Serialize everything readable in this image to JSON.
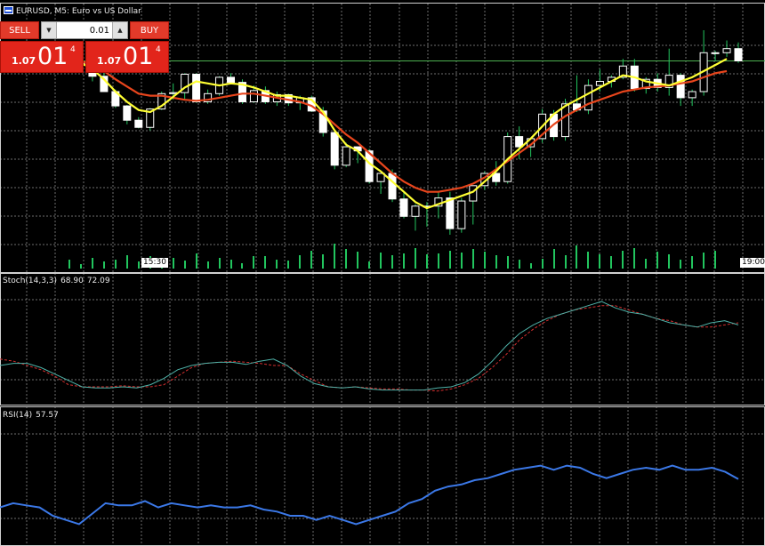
{
  "symbol_title": "EURUSD, M5:  Euro vs US Dollar",
  "trade_panel": {
    "sell_label": "SELL",
    "buy_label": "BUY",
    "lot_value": "0.01",
    "sell_price": {
      "small": "1.07",
      "big": "01",
      "sup": "4"
    },
    "buy_price": {
      "small": "1.07",
      "big": "01",
      "sup": "4"
    },
    "down_arrow": "▼",
    "up_arrow": "▲"
  },
  "time_labels": [
    "15:30",
    "19:00"
  ],
  "indicators": {
    "stoch": {
      "name": "Stoch(14,3,3)",
      "main": "68.90",
      "signal": "72.09"
    },
    "rsi": {
      "name": "RSI(14)",
      "value": "57.57"
    }
  },
  "colors": {
    "background": "#000000",
    "grid": "#c8c8c8",
    "bull": "#ffffff",
    "bear": "#ffffff",
    "wick": "#22c55e",
    "fast_ma": "#ffff33",
    "slow_ma": "#e8451c",
    "stoch_main": "#4fb3a9",
    "stoch_signal": "#d32f2f",
    "rsi": "#3b78e7",
    "volume": "#22c55e",
    "price_line": "#4caf50",
    "sell_button": "#e23a2a"
  },
  "chart_data": {
    "type": "candlestick",
    "candles": [
      {
        "o": 9,
        "h": 14,
        "l": 4,
        "c": 8
      },
      {
        "o": 8,
        "h": 10,
        "l": 6,
        "c": 8
      },
      {
        "o": 8,
        "h": 5,
        "l": -10,
        "c": -5
      },
      {
        "o": -5,
        "h": 14,
        "l": -12,
        "c": -20
      },
      {
        "o": -20,
        "h": -18,
        "l": -36,
        "c": -34
      },
      {
        "o": -34,
        "h": -33,
        "l": -52,
        "c": -48
      },
      {
        "o": -48,
        "h": -45,
        "l": -56,
        "c": -55
      },
      {
        "o": -55,
        "h": -36,
        "l": -58,
        "c": -37
      },
      {
        "o": -37,
        "h": -20,
        "l": -38,
        "c": -22
      },
      {
        "o": -22,
        "h": -12,
        "l": -28,
        "c": -21
      },
      {
        "o": -21,
        "h": -2,
        "l": -28,
        "c": -3
      },
      {
        "o": -3,
        "h": -2,
        "l": -31,
        "c": -30
      },
      {
        "o": -30,
        "h": -18,
        "l": -32,
        "c": -22
      },
      {
        "o": -22,
        "h": -5,
        "l": -24,
        "c": -6
      },
      {
        "o": -6,
        "h": -2,
        "l": -12,
        "c": -11
      },
      {
        "o": -11,
        "h": -8,
        "l": -32,
        "c": -30
      },
      {
        "o": -30,
        "h": -14,
        "l": -31,
        "c": -19
      },
      {
        "o": -19,
        "h": -15,
        "l": -32,
        "c": -30
      },
      {
        "o": -30,
        "h": -20,
        "l": -34,
        "c": -23
      },
      {
        "o": -23,
        "h": -22,
        "l": -34,
        "c": -31
      },
      {
        "o": -31,
        "h": -24,
        "l": -38,
        "c": -26
      },
      {
        "o": -26,
        "h": -24,
        "l": -40,
        "c": -39
      },
      {
        "o": -39,
        "h": -35,
        "l": -64,
        "c": -60
      },
      {
        "o": -60,
        "h": -58,
        "l": -96,
        "c": -92
      },
      {
        "o": -92,
        "h": -70,
        "l": -94,
        "c": -74
      },
      {
        "o": -74,
        "h": -76,
        "l": -90,
        "c": -78
      },
      {
        "o": -78,
        "h": -76,
        "l": -110,
        "c": -108
      },
      {
        "o": -108,
        "h": -100,
        "l": -120,
        "c": -100
      },
      {
        "o": -100,
        "h": -96,
        "l": -128,
        "c": -125
      },
      {
        "o": -125,
        "h": -118,
        "l": -144,
        "c": -142
      },
      {
        "o": -142,
        "h": -130,
        "l": -156,
        "c": -132
      },
      {
        "o": -132,
        "h": -128,
        "l": -152,
        "c": -132
      },
      {
        "o": -132,
        "h": -118,
        "l": -144,
        "c": -124
      },
      {
        "o": -124,
        "h": -118,
        "l": -160,
        "c": -154
      },
      {
        "o": -154,
        "h": -124,
        "l": -158,
        "c": -127
      },
      {
        "o": -127,
        "h": -112,
        "l": -150,
        "c": -112
      },
      {
        "o": -112,
        "h": -98,
        "l": -116,
        "c": -100
      },
      {
        "o": -100,
        "h": -88,
        "l": -112,
        "c": -108
      },
      {
        "o": -108,
        "h": -60,
        "l": -110,
        "c": -64
      },
      {
        "o": -64,
        "h": -54,
        "l": -86,
        "c": -74
      },
      {
        "o": -74,
        "h": -66,
        "l": -84,
        "c": -66
      },
      {
        "o": -66,
        "h": -37,
        "l": -70,
        "c": -42
      },
      {
        "o": -42,
        "h": -38,
        "l": -68,
        "c": -64
      },
      {
        "o": -64,
        "h": -27,
        "l": -68,
        "c": -32
      },
      {
        "o": -32,
        "h": -4,
        "l": -40,
        "c": -38
      },
      {
        "o": -38,
        "h": -8,
        "l": -42,
        "c": -14
      },
      {
        "o": -14,
        "h": 2,
        "l": -20,
        "c": -10
      },
      {
        "o": -10,
        "h": -4,
        "l": -16,
        "c": -6
      },
      {
        "o": -6,
        "h": 12,
        "l": -8,
        "c": 5
      },
      {
        "o": 5,
        "h": 12,
        "l": -20,
        "c": -17
      },
      {
        "o": -17,
        "h": -6,
        "l": -22,
        "c": -8
      },
      {
        "o": -8,
        "h": -2,
        "l": -20,
        "c": -16
      },
      {
        "o": -16,
        "h": 22,
        "l": -24,
        "c": -4
      },
      {
        "o": -4,
        "h": -2,
        "l": -34,
        "c": -26
      },
      {
        "o": -26,
        "h": -18,
        "l": -34,
        "c": -20
      },
      {
        "o": -20,
        "h": 40,
        "l": -24,
        "c": 18
      },
      {
        "o": 18,
        "h": 20,
        "l": 10,
        "c": 18
      },
      {
        "o": 18,
        "h": 30,
        "l": 14,
        "c": 22
      },
      {
        "o": 22,
        "h": 28,
        "l": 8,
        "c": 10
      }
    ],
    "fast_ma": [
      10,
      8,
      2,
      -8,
      -20,
      -30,
      -38,
      -40,
      -34,
      -25,
      -16,
      -10,
      -12,
      -14,
      -12,
      -13,
      -16,
      -20,
      -24,
      -24,
      -26,
      -28,
      -40,
      -58,
      -72,
      -78,
      -90,
      -98,
      -108,
      -118,
      -128,
      -134,
      -130,
      -126,
      -122,
      -118,
      -108,
      -98,
      -86,
      -76,
      -66,
      -54,
      -42,
      -34,
      -28,
      -22,
      -16,
      -10,
      -4,
      -6,
      -10,
      -12,
      -14,
      -10,
      -6,
      0,
      6,
      12
    ],
    "slow_ma": [
      12,
      10,
      6,
      0,
      -8,
      -15,
      -22,
      -24,
      -24,
      -26,
      -28,
      -29,
      -28,
      -26,
      -24,
      -22,
      -22,
      -24,
      -26,
      -28,
      -30,
      -34,
      -42,
      -52,
      -62,
      -70,
      -80,
      -90,
      -100,
      -108,
      -114,
      -118,
      -118,
      -116,
      -114,
      -110,
      -104,
      -96,
      -88,
      -80,
      -72,
      -62,
      -52,
      -44,
      -38,
      -32,
      -28,
      -24,
      -20,
      -18,
      -16,
      -15,
      -14,
      -12,
      -10,
      -6,
      -2,
      0
    ],
    "volume": [
      40,
      35,
      42,
      38,
      40,
      45,
      38,
      44,
      40,
      42,
      39,
      47,
      38,
      42,
      40,
      36,
      44,
      44,
      40,
      39,
      45,
      50,
      46,
      58,
      52,
      49,
      38,
      48,
      45,
      47,
      53,
      46,
      47,
      50,
      48,
      52,
      49,
      45,
      44,
      40,
      36,
      41,
      52,
      45,
      56,
      49,
      46,
      44,
      50,
      53,
      41,
      49,
      46,
      40,
      44,
      48,
      50
    ],
    "stoch_main": [
      30,
      32,
      32,
      28,
      22,
      16,
      10,
      9,
      9,
      10,
      9,
      12,
      18,
      26,
      30,
      32,
      33,
      33,
      31,
      34,
      36,
      30,
      20,
      13,
      10,
      9,
      10,
      8,
      7,
      7,
      7,
      7,
      9,
      10,
      14,
      22,
      34,
      48,
      60,
      68,
      74,
      78,
      82,
      86,
      90,
      84,
      80,
      78,
      74,
      70,
      68,
      66,
      70,
      72,
      68
    ],
    "stoch_signal": [
      36,
      34,
      30,
      26,
      20,
      12,
      10,
      10,
      10,
      11,
      10,
      10,
      12,
      20,
      28,
      32,
      33,
      34,
      33,
      32,
      30,
      30,
      22,
      16,
      10,
      9,
      10,
      9,
      8,
      8,
      7,
      7,
      6,
      8,
      12,
      18,
      28,
      40,
      54,
      64,
      72,
      78,
      82,
      84,
      86,
      86,
      82,
      78,
      74,
      72,
      68,
      66,
      66,
      68,
      70
    ],
    "rsi": [
      44,
      46,
      45,
      44,
      40,
      38,
      36,
      41,
      46,
      45,
      45,
      47,
      44,
      46,
      45,
      44,
      45,
      44,
      44,
      45,
      43,
      42,
      40,
      40,
      38,
      40,
      38,
      36,
      38,
      40,
      42,
      46,
      48,
      52,
      54,
      55,
      57,
      58,
      60,
      62,
      63,
      64,
      62,
      64,
      63,
      60,
      58,
      60,
      62,
      63,
      62,
      64,
      62,
      62,
      63,
      61,
      57.57
    ]
  }
}
